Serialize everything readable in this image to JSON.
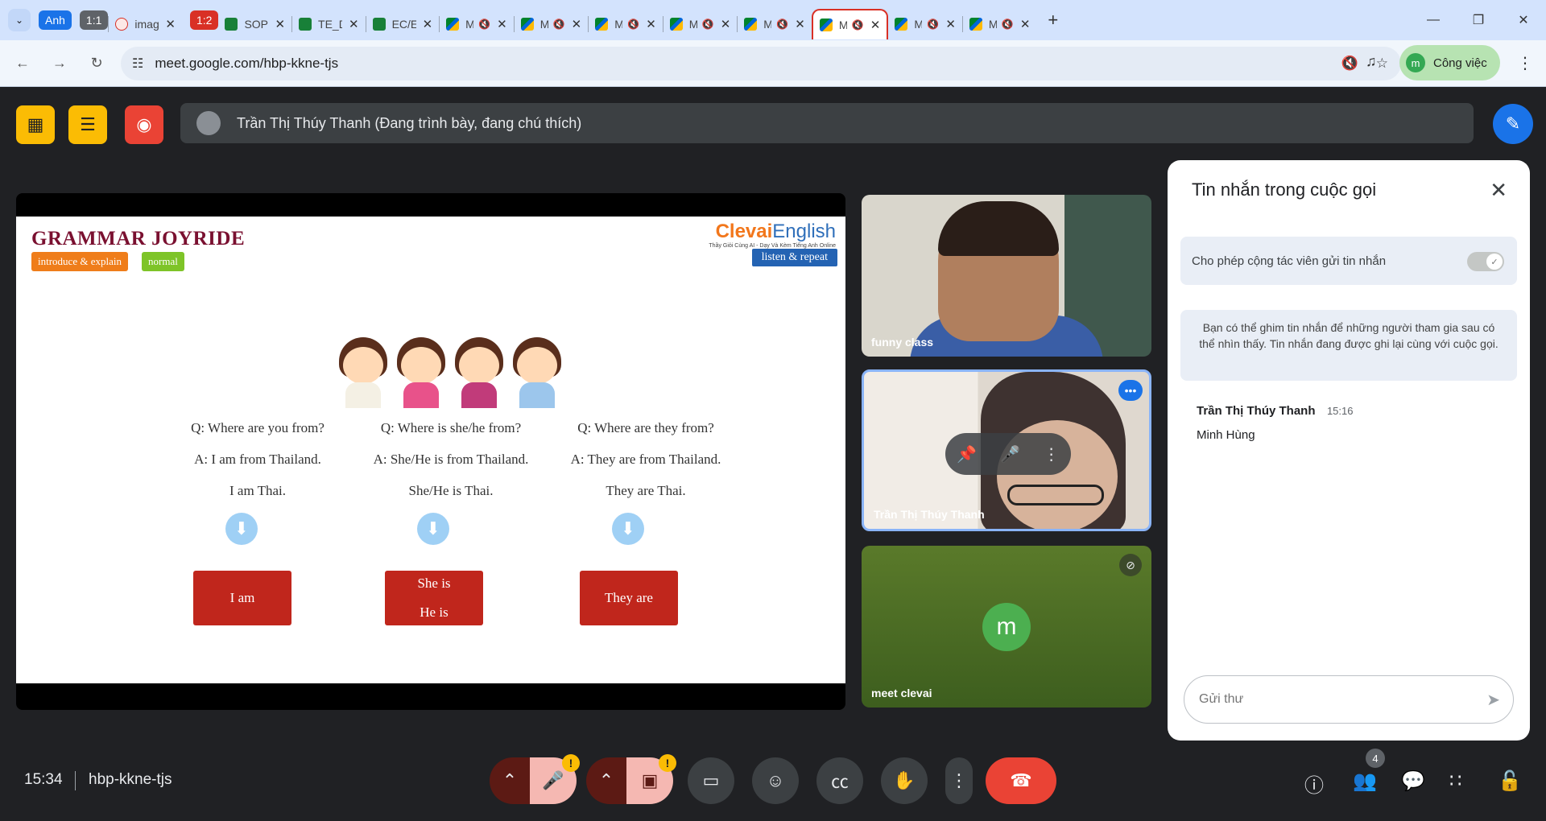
{
  "browser": {
    "tab_group_label": "Anh",
    "tabs": [
      {
        "kind": "group-chip",
        "label": "1:1",
        "color": "#5f6368"
      },
      {
        "kind": "tab",
        "title": "imag",
        "favicon": "image-tab-icon"
      },
      {
        "kind": "group-chip",
        "label": "1:2",
        "color": "#d93025"
      },
      {
        "kind": "tab",
        "title": "SOP",
        "favicon": "sheets-icon"
      },
      {
        "kind": "tab",
        "title": "TE_D",
        "favicon": "sheets-icon"
      },
      {
        "kind": "tab",
        "title": "EC/E",
        "favicon": "sheets-icon"
      },
      {
        "kind": "tab",
        "title": "M",
        "favicon": "meet-icon"
      },
      {
        "kind": "tab",
        "title": "M",
        "favicon": "meet-icon"
      },
      {
        "kind": "tab",
        "title": "M",
        "favicon": "meet-icon"
      },
      {
        "kind": "tab",
        "title": "M",
        "favicon": "meet-icon"
      },
      {
        "kind": "tab",
        "title": "M",
        "favicon": "meet-icon"
      },
      {
        "kind": "tab",
        "title": "M",
        "favicon": "meet-icon",
        "active": true
      },
      {
        "kind": "tab",
        "title": "M",
        "favicon": "meet-icon"
      },
      {
        "kind": "tab",
        "title": "M",
        "favicon": "meet-icon"
      }
    ],
    "url": "meet.google.com/hbp-kkne-tjs",
    "profile_label": "Công việc",
    "profile_initial": "m"
  },
  "meet": {
    "presenter_text": "Trần Thị Thúy Thanh (Đang trình bày, đang chú thích)",
    "time": "15:34",
    "meeting_code": "hbp-kkne-tjs",
    "participants_count": "4",
    "warning_glyph": "!"
  },
  "slide": {
    "title": "GRAMMAR JOYRIDE",
    "tag1": "introduce & explain",
    "tag2": "normal",
    "brand_main": "Clevai",
    "brand_en": "English",
    "brand_sub": "Thầy Giỏi Cùng AI - Dạy Và Kèm Tiếng Anh Online",
    "listen_label": "listen & repeat",
    "columns": [
      {
        "q": "Q: Where are you from?",
        "a": "A: I am from Thailand.",
        "b": "I am Thai.",
        "box1": "I am",
        "box2": ""
      },
      {
        "q": "Q: Where is she/he from?",
        "a": "A: She/He is from Thailand.",
        "b": "She/He is Thai.",
        "box1": "She is",
        "box2": "He is"
      },
      {
        "q": "Q: Where are they from?",
        "a": "A: They are from Thailand.",
        "b": "They are Thai.",
        "box1": "They are",
        "box2": ""
      }
    ]
  },
  "tiles": [
    {
      "name": "funny class"
    },
    {
      "name": "Trần Thị Thúy Thanh"
    },
    {
      "name": "meet clevai",
      "initial": "m"
    }
  ],
  "chat": {
    "title": "Tin nhắn trong cuộc gọi",
    "allow_label": "Cho phép cộng tác viên gửi tin nhắn",
    "info": "Bạn có thể ghim tin nhắn để những người tham gia sau có thể nhìn thấy. Tin nhắn đang được ghi lại cùng với cuộc gọi.",
    "messages": [
      {
        "sender": "Trần Thị Thúy Thanh",
        "time": "15:16",
        "text": "Minh Hùng"
      }
    ],
    "input_placeholder": "Gửi thư"
  }
}
